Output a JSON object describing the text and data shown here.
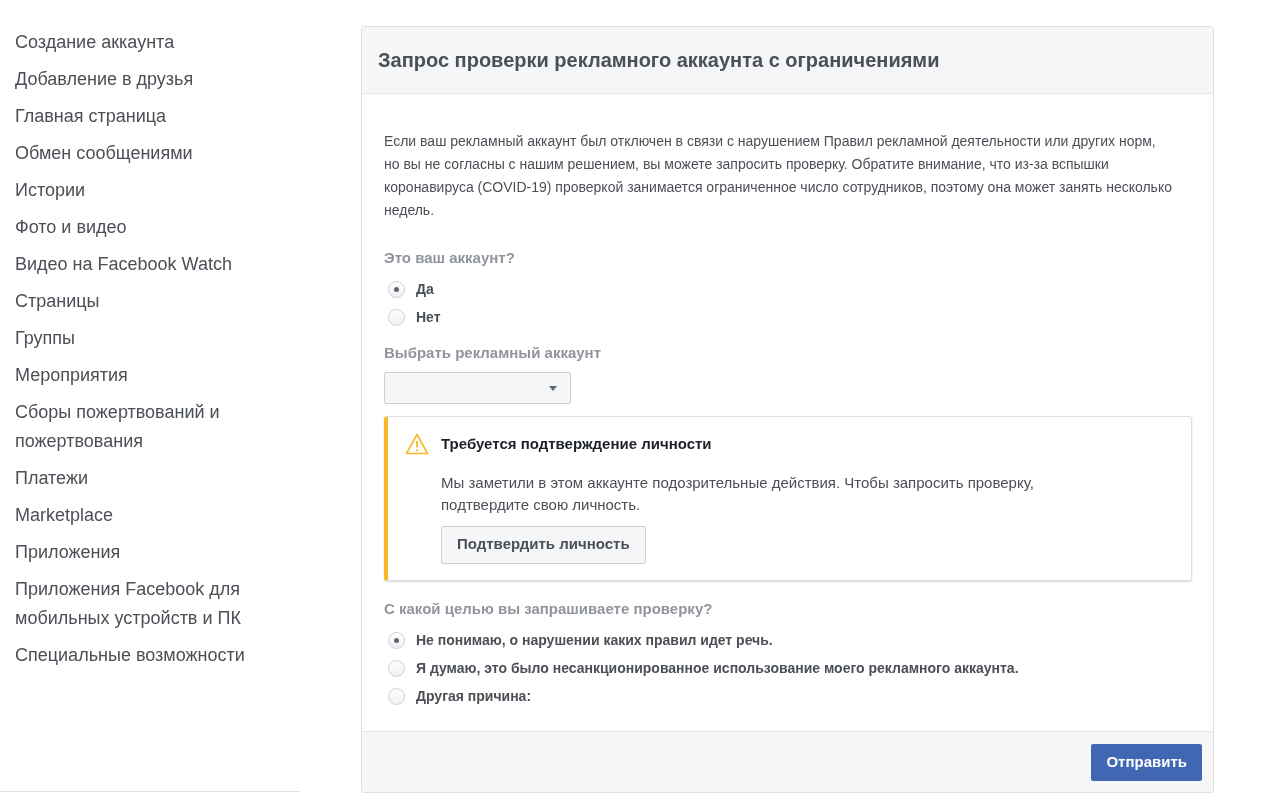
{
  "sidebar": {
    "items": [
      {
        "label": "Создание аккаунта"
      },
      {
        "label": "Добавление в друзья"
      },
      {
        "label": "Главная страница"
      },
      {
        "label": "Обмен сообщениями"
      },
      {
        "label": "Истории"
      },
      {
        "label": "Фото и видео"
      },
      {
        "label": "Видео на Facebook Watch"
      },
      {
        "label": "Страницы"
      },
      {
        "label": "Группы"
      },
      {
        "label": "Мероприятия"
      },
      {
        "label": "Сборы пожертвований и пожертвования"
      },
      {
        "label": "Платежи"
      },
      {
        "label": "Marketplace"
      },
      {
        "label": "Приложения"
      },
      {
        "label": "Приложения Facebook для мобильных устройств и ПК"
      },
      {
        "label": "Специальные возможности"
      }
    ]
  },
  "form": {
    "title": "Запрос проверки рекламного аккаунта с ограничениями",
    "description": "Если ваш рекламный аккаунт был отключен в связи с нарушением Правил рекламной деятельности или других норм, но вы не согласны с нашим решением, вы можете запросить проверку. Обратите внимание, что из-за вспышки коронавируса (COVID-19) проверкой занимается ограниченное число сотрудников, поэтому она может занять несколько недель.",
    "own_account": {
      "label": "Это ваш аккаунт?",
      "options": [
        {
          "label": "Да",
          "selected": true
        },
        {
          "label": "Нет",
          "selected": false
        }
      ]
    },
    "ad_account": {
      "label": "Выбрать рекламный аккаунт"
    },
    "alert": {
      "title": "Требуется подтверждение личности",
      "text": "Мы заметили в этом аккаунте подозрительные действия. Чтобы запросить проверку, подтвердите свою личность.",
      "button": "Подтвердить личность"
    },
    "reason": {
      "label": "С какой целью вы запрашиваете проверку?",
      "options": [
        {
          "label": "Не понимаю, о нарушении каких правил идет речь.",
          "selected": true
        },
        {
          "label": "Я думаю, это было несанкционированное использование моего рекламного аккаунта.",
          "selected": false
        },
        {
          "label": "Другая причина:",
          "selected": false
        }
      ]
    },
    "submit": "Отправить"
  }
}
